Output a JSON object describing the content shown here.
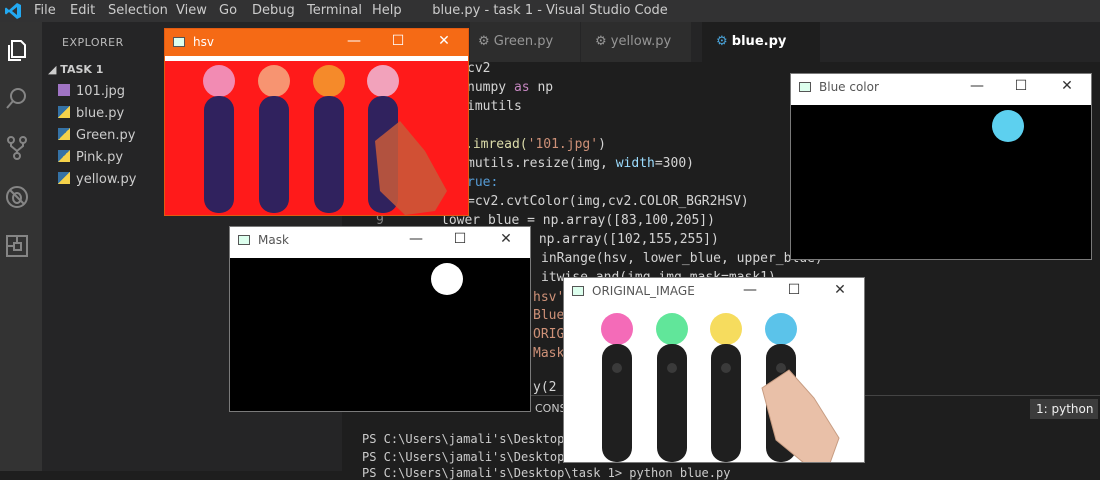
{
  "window": {
    "title": "blue.py - task 1 - Visual Studio Code"
  },
  "menu": [
    "File",
    "Edit",
    "Selection",
    "View",
    "Go",
    "Debug",
    "Terminal",
    "Help"
  ],
  "activity": [
    "files-icon",
    "search-icon",
    "source-control-icon",
    "debug-icon",
    "extensions-icon"
  ],
  "sidebar": {
    "title": "EXPLORER",
    "folder": "TASK 1",
    "files": [
      {
        "name": "101.jpg",
        "icon": "image-icon",
        "color": "#a074c4"
      },
      {
        "name": "blue.py",
        "icon": "python-icon",
        "color": "#3572A5"
      },
      {
        "name": "Green.py",
        "icon": "python-icon",
        "color": "#3572A5"
      },
      {
        "name": "Pink.py",
        "icon": "python-icon",
        "color": "#3572A5"
      },
      {
        "name": "yellow.py",
        "icon": "python-icon",
        "color": "#3572A5"
      }
    ]
  },
  "tabs": [
    {
      "label": "Green.py",
      "active": false
    },
    {
      "label": "yellow.py",
      "active": false
    },
    {
      "label": "blue.py",
      "active": true,
      "close": "×"
    }
  ],
  "code": {
    "l1_b": "cv2",
    "l2_a": "numpy ",
    "l2_kw": "as",
    "l2_b": " np",
    "l3": "imutils",
    "l5_a": ".imread(",
    "l5_s": "'101.jpg'",
    "l5_b": ")",
    "l6_a": "mutils.resize(img, ",
    "l6_v": "width",
    "l6_b": "=300)",
    "l7": "rue:",
    "l8": "=cv2.cvtColor(img,cv2.COLOR_BGR2HSV)",
    "l9_num": "9",
    "l9": "lower_blue = np.array([83,100,205])",
    "l10": " np.array([102,155,255])",
    "l11": "inRange(hsv, lower_blue, upper_blue)",
    "l12": "itwise_and(img,img,mask=mask1)",
    "l13": "hsv'",
    "l14": "Blue",
    "l15": "ORIG",
    "l16": "Mask",
    "l18": "y(2"
  },
  "panel": {
    "console_label": "CONS",
    "terminal_select": "1: python",
    "lines": [
      "PS C:\\Users\\jamali's\\Desktop\\",
      "PS C:\\Users\\jamali's\\Desktop\\",
      "PS C:\\Users\\jamali's\\Desktop\\task 1> python blue.py"
    ]
  },
  "cv_windows": {
    "hsv": {
      "title": "hsv"
    },
    "mask": {
      "title": "Mask"
    },
    "blue": {
      "title": "Blue color"
    },
    "original": {
      "title": "ORIGINAL_IMAGE"
    }
  },
  "window_controls": {
    "minimize": "—",
    "maximize": "☐",
    "close": "✕"
  },
  "colors": {
    "hsv_bg": "#ff1a1a",
    "mask_blob": "#ffffff",
    "blue_blob": "#5dd0ef",
    "controller_pink": "#f46bb8",
    "controller_green": "#61e69a",
    "controller_yellow": "#f6dc5e",
    "controller_blue": "#5bc3ea"
  }
}
